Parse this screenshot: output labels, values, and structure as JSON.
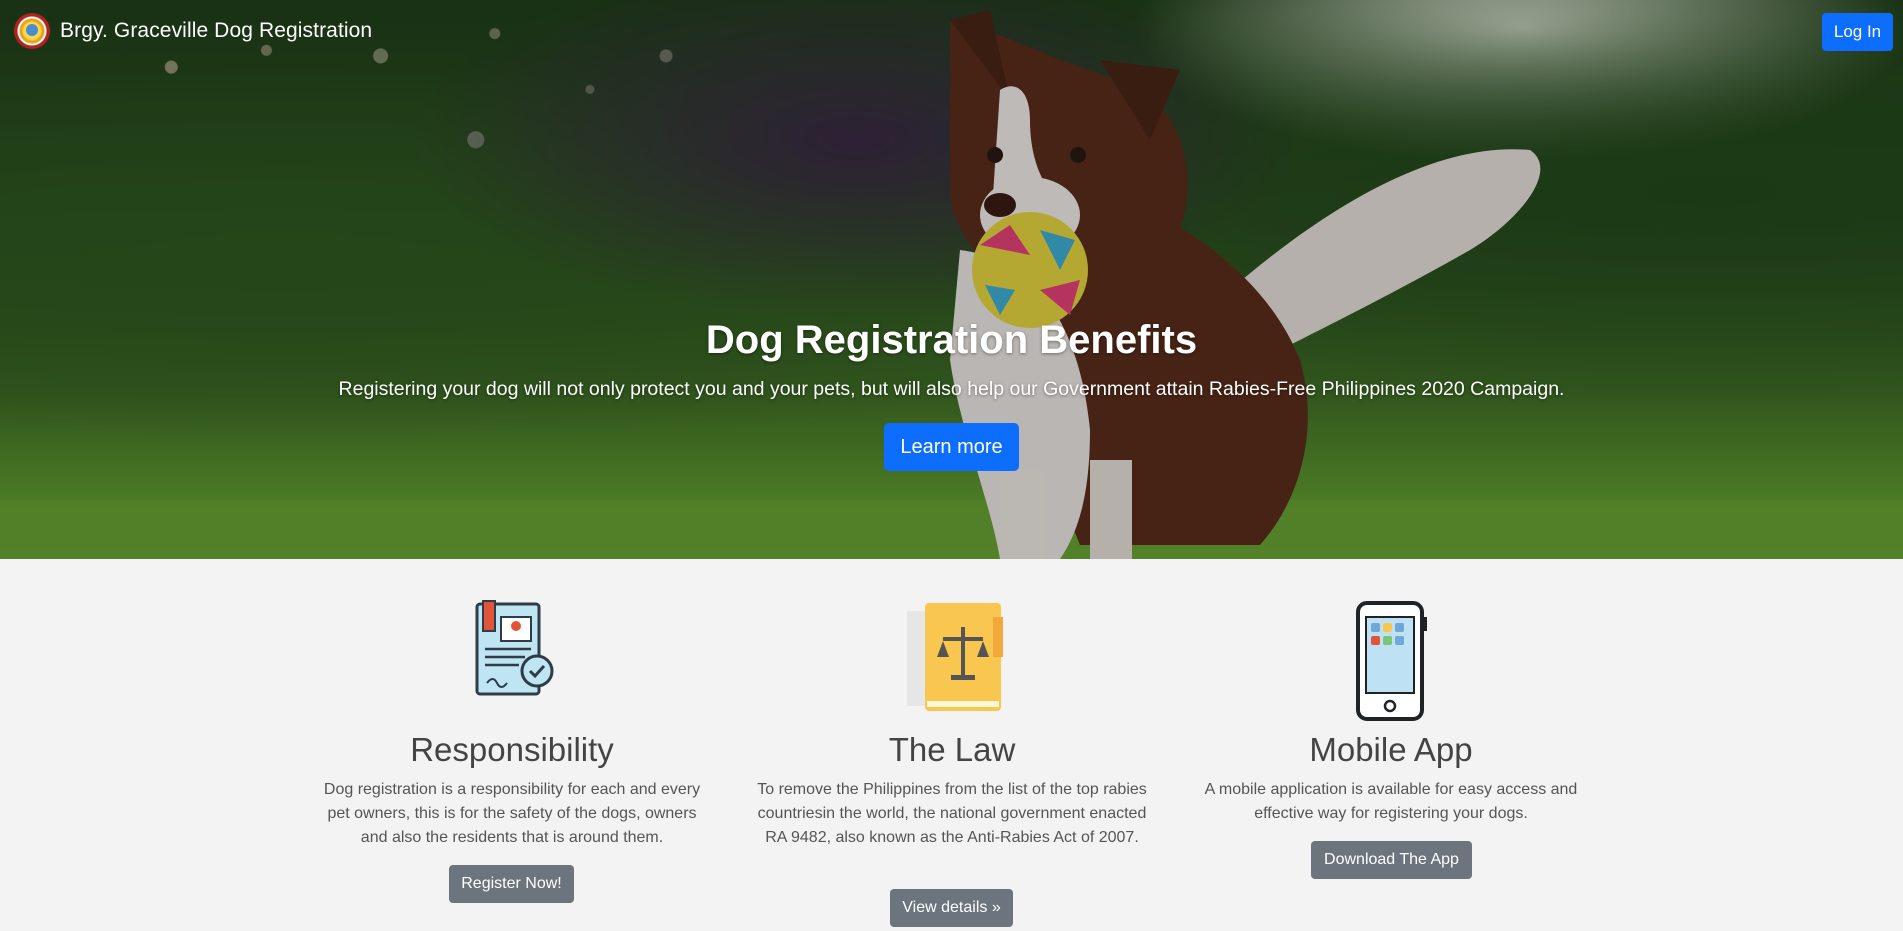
{
  "navbar": {
    "brand_title": "Brgy. Graceville Dog Registration",
    "login_label": "Log In"
  },
  "hero": {
    "title": "Dog Registration Benefits",
    "subtitle": "Registering your dog will not only protect you and your pets, but will also help our Government attain Rabies-Free Philippines 2020 Campaign.",
    "cta_label": "Learn more"
  },
  "features": [
    {
      "icon": "certificate-icon",
      "title": "Responsibility",
      "text": "Dog registration is a responsibility for each and every pet owners, this is for the safety of the dogs, owners and also the residents that is around them.",
      "button_label": "Register Now!"
    },
    {
      "icon": "law-scale-book-icon",
      "title": "The Law",
      "text": "To remove the Philippines from the list of the top rabies countriesin the world, the national government enacted RA 9482, also known as the Anti-Rabies Act of 2007.",
      "button_label": "View details »"
    },
    {
      "icon": "mobile-phone-icon",
      "title": "Mobile App",
      "text": "A mobile application is available for easy access and effective way for registering your dogs.",
      "button_label": "Download The App"
    }
  ],
  "colors": {
    "primary": "#0d6efd",
    "secondary": "#6c757d",
    "section_bg": "#f3f3f3"
  }
}
